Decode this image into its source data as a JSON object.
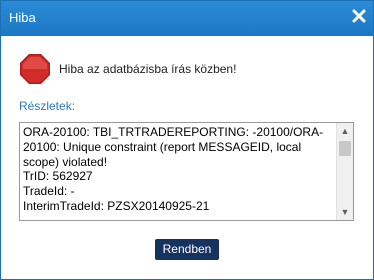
{
  "dialog": {
    "title": "Hiba",
    "close_icon": "close-icon",
    "message": "Hiba az adatbázisba írás közben!",
    "message_icon": "stop-icon",
    "details_label": "Részletek:",
    "details_text": "ORA-20100: TBI_TRTRADEREPORTING: -20100/ORA-20100: Unique constraint (report MESSAGEID, local scope) violated!\nTrID: 562927\nTradeId: -\nInterimTradeId: PZSX20140925-21",
    "ok_label": "Rendben"
  },
  "colors": {
    "titlebar": "#1c78c4",
    "accent_text": "#2a7ab8",
    "button": "#16325f",
    "stop_red": "#d32a2a"
  }
}
